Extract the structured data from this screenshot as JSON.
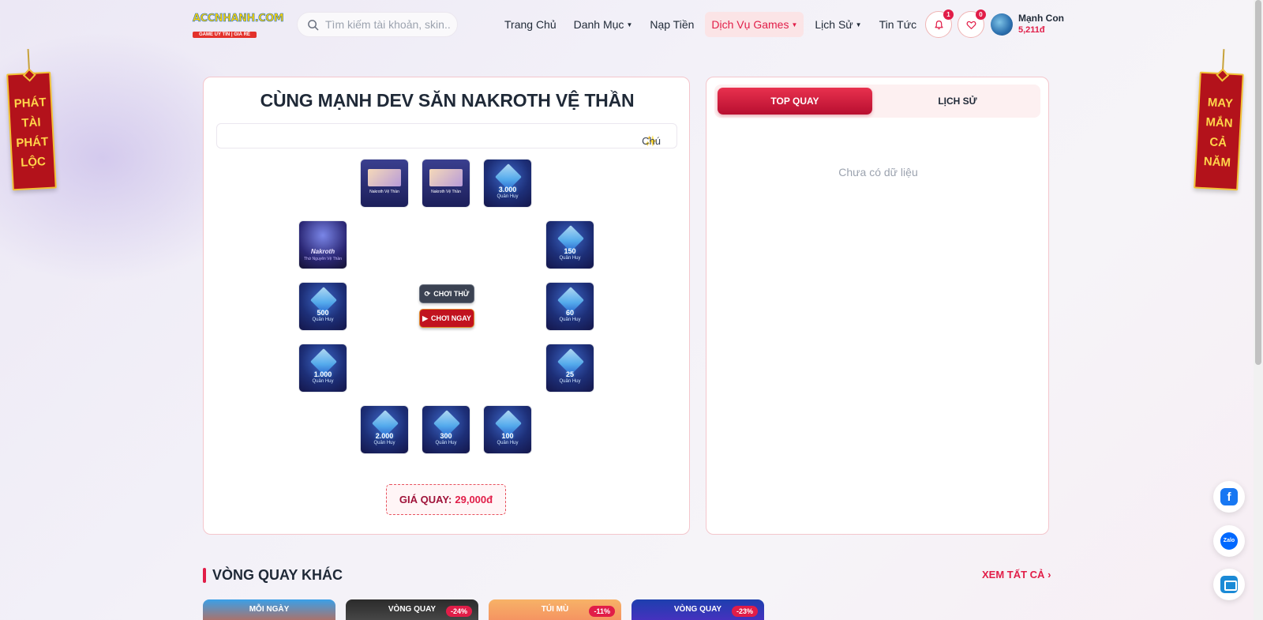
{
  "header": {
    "logo_main": "ACCNHANH.COM",
    "logo_tagline": "GAME UY TÍN | GIÁ RẺ",
    "search_placeholder": "Tìm kiếm tài khoản, skin...",
    "nav": [
      {
        "label": "Trang Chủ",
        "dropdown": false
      },
      {
        "label": "Danh Mục",
        "dropdown": true
      },
      {
        "label": "Nạp Tiền",
        "dropdown": false
      },
      {
        "label": "Dịch Vụ Games",
        "dropdown": true,
        "active": true
      },
      {
        "label": "Lịch Sử",
        "dropdown": true
      },
      {
        "label": "Tin Tức",
        "dropdown": false
      }
    ],
    "notifications_count": "1",
    "favorites_count": "0",
    "user_name": "Mạnh Con",
    "user_balance": "5,211đ"
  },
  "banners": {
    "left": [
      "PHÁT",
      "TÀI",
      "PHÁT",
      "LỘC"
    ],
    "right": [
      "MAY",
      "MẮN",
      "CẢ",
      "NĂM"
    ]
  },
  "wheel": {
    "title": "CÙNG MẠNH DEV SĂN NAKROTH VỆ THẦN",
    "marquee": "Chú",
    "prizes": [
      {
        "type": "card",
        "caption": "Nakroth Vệ Thần"
      },
      {
        "type": "card",
        "caption": "Nakroth Vệ Thần"
      },
      {
        "type": "qh",
        "amount": "3.000",
        "label": "Quân Huy"
      },
      {
        "type": "hero",
        "caption": "Nakroth",
        "caption2": "Thứ Nguyên Vệ Thần"
      },
      {
        "type": "qh",
        "amount": "150",
        "label": "Quân Huy"
      },
      {
        "type": "qh",
        "amount": "500",
        "label": "Quân Huy"
      },
      {
        "type": "qh",
        "amount": "60",
        "label": "Quân Huy"
      },
      {
        "type": "qh",
        "amount": "1.000",
        "label": "Quân Huy"
      },
      {
        "type": "qh",
        "amount": "25",
        "label": "Quân Huy"
      },
      {
        "type": "qh",
        "amount": "2.000",
        "label": "Quân Huy"
      },
      {
        "type": "qh",
        "amount": "300",
        "label": "Quân Huy"
      },
      {
        "type": "qh",
        "amount": "100",
        "label": "Quân Huy"
      }
    ],
    "try_label": "CHƠI THỬ",
    "play_label": "CHƠI NGAY",
    "price_label": "GIÁ QUAY:",
    "price_value": "29,000đ"
  },
  "side": {
    "tab_top": "TOP QUAY",
    "tab_history": "LỊCH SỬ",
    "empty_text": "Chưa có dữ liệu"
  },
  "other": {
    "title": "VÒNG QUAY KHÁC",
    "see_all": "XEM TẤT CẢ",
    "thumbs": [
      {
        "label": "MỖI NGÀY",
        "discount": ""
      },
      {
        "label": "VÒNG QUAY",
        "discount": "-24%"
      },
      {
        "label": "TÚI MÙ",
        "discount": "-11%"
      },
      {
        "label": "VÒNG QUAY",
        "discount": "-23%"
      }
    ]
  },
  "colors": {
    "accent": "#e11d48",
    "banner_red": "#b3121b",
    "banner_gold": "#f2c237"
  }
}
